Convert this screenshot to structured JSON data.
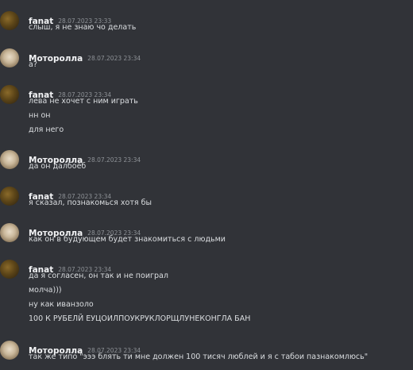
{
  "messages": [
    {
      "author": "fanat",
      "time": "28.07.2023 23:33",
      "lines": [
        "слыш, я не знаю чо делать"
      ]
    },
    {
      "author": "Моторолла",
      "time": "28.07.2023 23:34",
      "lines": [
        "а?"
      ]
    },
    {
      "author": "fanat",
      "time": "28.07.2023 23:34",
      "lines": [
        "лева не хочет с ним играть",
        "нн он",
        "для него"
      ]
    },
    {
      "author": "Моторолла",
      "time": "28.07.2023 23:34",
      "lines": [
        "да он далбоёб"
      ]
    },
    {
      "author": "fanat",
      "time": "28.07.2023 23:34",
      "lines": [
        "я сказал, познакомься хотя бы"
      ]
    },
    {
      "author": "Моторолла",
      "time": "28.07.2023 23:34",
      "lines": [
        "как он в будующем будет знакомиться с людьми"
      ]
    },
    {
      "author": "fanat",
      "time": "28.07.2023 23:34",
      "lines": [
        "да я согласен, он так и не поиграл",
        "молча)))",
        "ну как иванзоло",
        "100 К РУБЕЛЙ ЕУЦОИЛПОУКРУКЛОРЩЛУНЕКОНГЛА БАН"
      ]
    },
    {
      "author": "Моторолла",
      "time": "28.07.2023 23:34",
      "lines": [
        "так же типо \"эээ блять ти мне должен 100 тисяч люблей и я с табои пазнакомлюсь\""
      ]
    }
  ]
}
